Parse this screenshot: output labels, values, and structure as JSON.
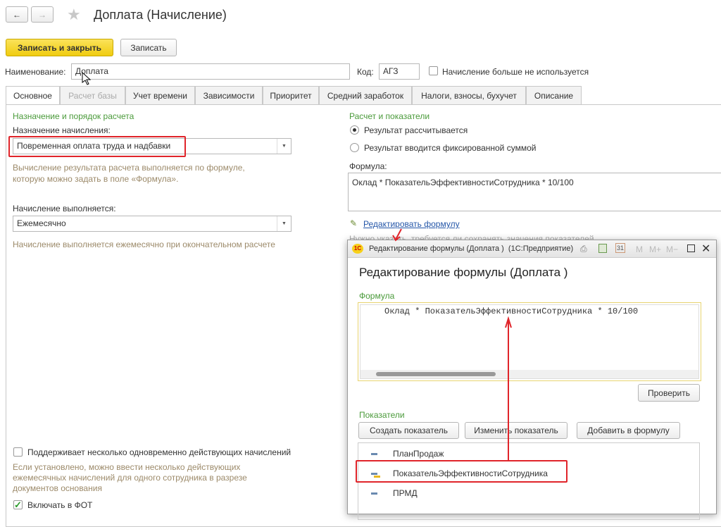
{
  "header": {
    "title": "Доплата (Начисление)",
    "back": "←",
    "forward": "→",
    "star": "★"
  },
  "toolbar": {
    "save_close": "Записать и закрыть",
    "save": "Записать"
  },
  "name_row": {
    "name_label": "Наименование:",
    "name_value": "Доплата",
    "code_label": "Код:",
    "code_value": "АГЗ",
    "unused_label": "Начисление больше не используется"
  },
  "tabs": [
    "Основное",
    "Расчет базы",
    "Учет времени",
    "Зависимости",
    "Приоритет",
    "Средний заработок",
    "Налоги, взносы, бухучет",
    "Описание"
  ],
  "left": {
    "section": "Назначение и порядок расчета",
    "purpose_label": "Назначение начисления:",
    "purpose_value": "Повременная оплата труда и надбавки",
    "purpose_hint1": "Вычисление результата расчета выполняется по формуле,",
    "purpose_hint2": "которую можно задать в поле «Формула».",
    "period_label": "Начисление выполняется:",
    "period_value": "Ежемесячно",
    "period_hint": "Начисление выполняется ежемесячно при окончательном расчете",
    "multi_label": "Поддерживает несколько одновременно действующих начислений",
    "multi_hint1": "Если установлено, можно ввести несколько действующих",
    "multi_hint2": "ежемесячных начислений для одного сотрудника в разрезе",
    "multi_hint3": "документов основания",
    "fot_label": "Включать в ФОТ"
  },
  "right": {
    "section": "Расчет и показатели",
    "radio1": "Результат рассчитывается",
    "radio2": "Результат вводится фиксированной суммой",
    "formula_label": "Формула:",
    "formula_value": "Оклад * ПоказательЭффективностиСотрудника * 10/100",
    "edit_link": "Редактировать формулу",
    "hidden_hint": "Нужно указать, требуется ли сохранять значения показателей"
  },
  "dialog": {
    "window_title": "Редактирование формулы (Доплата )  (1С:Предприятие)",
    "logo": "1С",
    "m": "M",
    "mplus": "M+",
    "mminus": "M−",
    "heading": "Редактирование формулы (Доплата )",
    "formula_label": "Формула",
    "formula_value": "Оклад * ПоказательЭффективностиСотрудника * 10/100",
    "check_btn": "Проверить",
    "indicators_label": "Показатели",
    "create_btn": "Создать показатель",
    "change_btn": "Изменить показатель",
    "add_btn": "Добавить в формулу",
    "indicators": [
      "ПланПродаж",
      "ПоказательЭффективностиСотрудника",
      "ПРМД"
    ]
  },
  "colors": {
    "accent": "#f5d217",
    "green": "#4a9a3a",
    "highlight": "#e0242a"
  }
}
